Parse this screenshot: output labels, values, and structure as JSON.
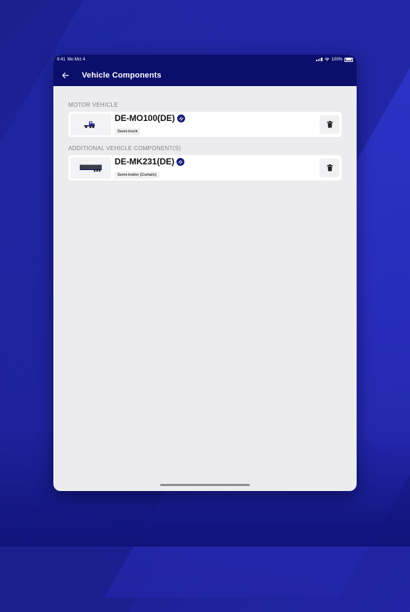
{
  "status": {
    "time": "9:41",
    "date": "Mo Mrz 4",
    "battery": "100%"
  },
  "nav": {
    "title": "Vehicle Components"
  },
  "sections": [
    {
      "label": "MOTOR VEHICLE",
      "item": {
        "plate": "DE-MO100(DE)",
        "type": "Semi-truck",
        "icon": "semi-truck-icon"
      }
    },
    {
      "label": "ADDITIONAL VEHICLE COMPONENT(S)",
      "item": {
        "plate": "DE-MK231(DE)",
        "type": "Semi-trailer (Curtain)",
        "icon": "trailer-icon"
      }
    }
  ],
  "colors": {
    "header": "#0b0f6b",
    "background": "#ececef",
    "accent": "#101574"
  }
}
